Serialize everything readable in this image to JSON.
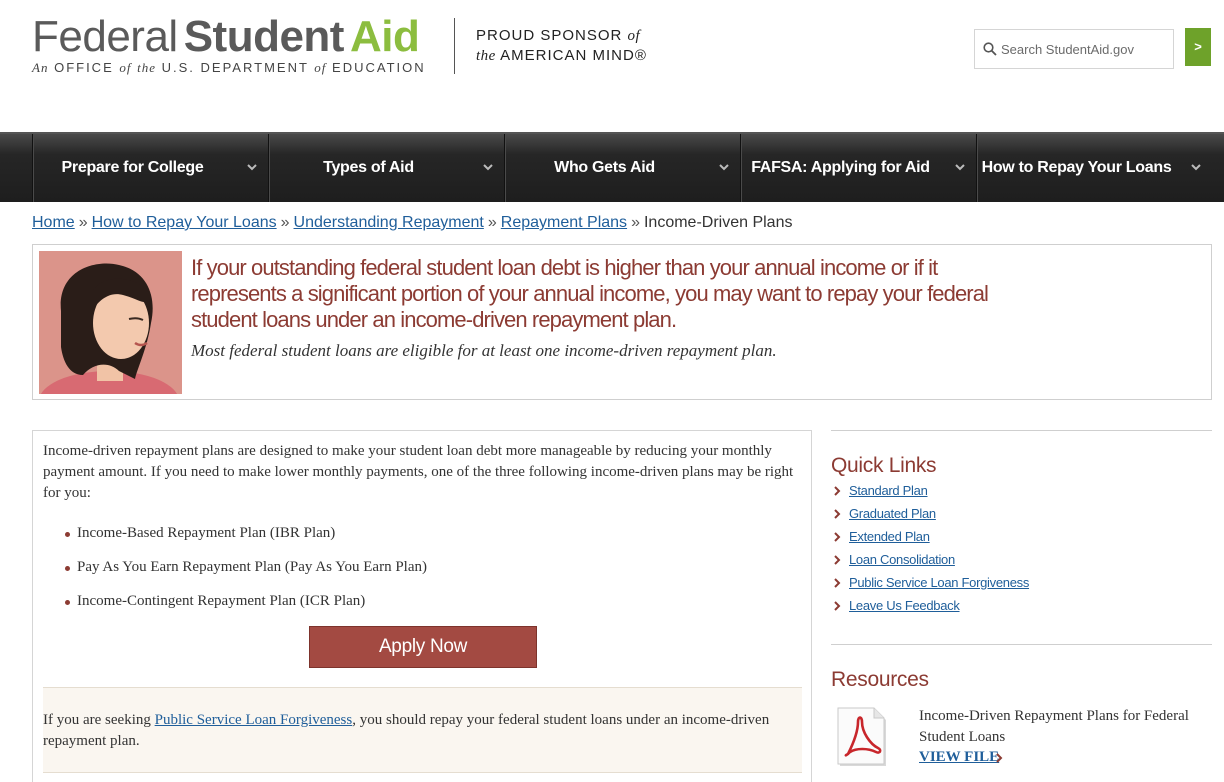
{
  "header": {
    "logo": {
      "federal": "Federal",
      "student": "Student",
      "aid": "Aid",
      "tagline_parts": [
        "An",
        "OFFICE",
        "of",
        "the",
        "U.S. DEPARTMENT",
        "of",
        "EDUCATION"
      ]
    },
    "sponsor": {
      "line1": "PROUD SPONSOR",
      "line1_italic": "of",
      "line2_italic": "the",
      "line2": "AMERICAN MIND®"
    },
    "search": {
      "placeholder": "Search StudentAid.gov",
      "button_label": ">"
    }
  },
  "nav": {
    "items": [
      {
        "label": "Prepare for College"
      },
      {
        "label": "Types of Aid"
      },
      {
        "label": "Who Gets Aid"
      },
      {
        "label": "FAFSA: Applying for Aid"
      },
      {
        "label": "How to Repay Your Loans"
      }
    ]
  },
  "breadcrumb": {
    "items": [
      "Home",
      "How to Repay Your Loans",
      "Understanding Repayment",
      "Repayment Plans"
    ],
    "current": "Income-Driven Plans",
    "separator": "»"
  },
  "hero": {
    "headline": "If your outstanding federal student loan debt is higher than your annual income or if it represents a significant portion of your annual income, you may want to repay your federal student loans under an income-driven repayment plan.",
    "subline": "Most federal student loans are eligible for at least one income-driven repayment plan."
  },
  "main": {
    "intro": "Income-driven repayment plans are designed to make your student loan debt more manageable by reducing your monthly payment amount. If you need to make lower monthly payments, one of the three following income-driven plans may be right for you:",
    "plans": [
      "Income-Based Repayment Plan (IBR Plan)",
      "Pay As You Earn Repayment Plan (Pay As You Earn Plan)",
      "Income-Contingent Repayment Plan (ICR Plan)"
    ],
    "apply_label": "Apply Now",
    "pslf": {
      "before": "If you are seeking ",
      "link": "Public Service Loan Forgiveness",
      "after": ", you should repay your federal student loans under an income-driven repayment plan."
    }
  },
  "sidebar": {
    "quick_links_title": "Quick Links",
    "quick_links": [
      "Standard Plan",
      "Graduated Plan",
      "Extended Plan",
      "Loan Consolidation",
      "Public Service Loan Forgiveness",
      "Leave Us Feedback"
    ],
    "resources_title": "Resources",
    "resource": {
      "title": "Income-Driven Repayment Plans for Federal Student Loans",
      "link": "VIEW FILE"
    }
  },
  "colors": {
    "brand_green": "#8cbd3f",
    "accent_red": "#8c3b33",
    "link_blue": "#1f5e9a",
    "nav_bg": "#262626"
  }
}
